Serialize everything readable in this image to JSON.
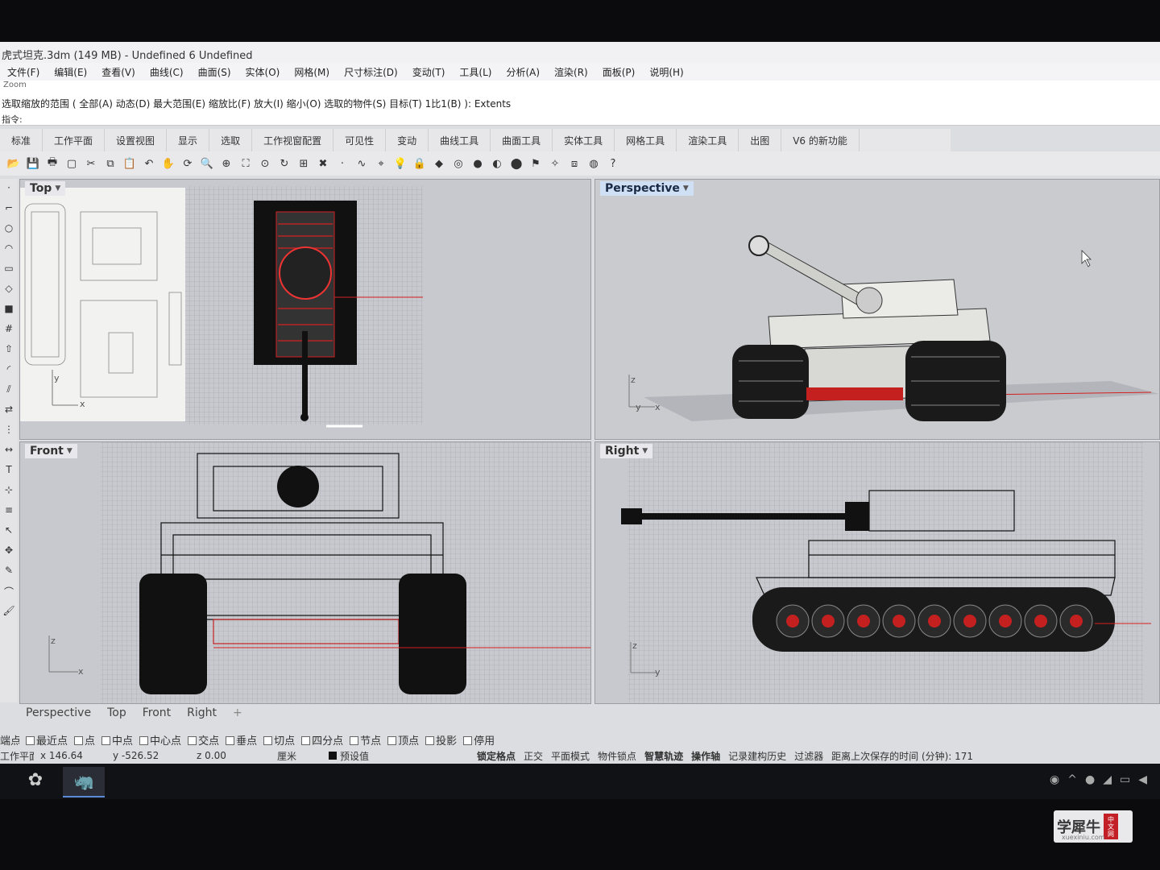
{
  "window": {
    "title": "虎式坦克.3dm (149 MB) - Undefined 6 Undefined"
  },
  "menu": [
    "文件(F)",
    "编辑(E)",
    "查看(V)",
    "曲线(C)",
    "曲面(S)",
    "实体(O)",
    "网格(M)",
    "尺寸标注(D)",
    "变动(T)",
    "工具(L)",
    "分析(A)",
    "渲染(R)",
    "面板(P)",
    "说明(H)"
  ],
  "command": {
    "history": "Zoom",
    "prompt": "选取缩放的范围 ( 全部(A)  动态(D)  最大范围(E)  缩放比(F)  放大(I)  缩小(O)  选取的物件(S)  目标(T)  1比1(B) ):  Extents",
    "input_label": "指令:",
    "input_value": ""
  },
  "tabs": [
    "标准",
    "工作平面",
    "设置视图",
    "显示",
    "选取",
    "工作视窗配置",
    "可见性",
    "变动",
    "曲线工具",
    "曲面工具",
    "实体工具",
    "网格工具",
    "渲染工具",
    "出图",
    "V6 的新功能"
  ],
  "toolbar_icons": [
    "open-icon",
    "save-icon",
    "print-icon",
    "new-icon",
    "cut-icon",
    "copy-icon",
    "paste-icon",
    "undo-icon",
    "pan-icon",
    "rotate-icon",
    "zoom-icon",
    "zoom-window-icon",
    "zoom-extents-icon",
    "zoom-selected-icon",
    "rotate-view-icon",
    "layout-icon",
    "delete-icon",
    "point-icon",
    "curve-icon",
    "osnap-icon",
    "light-icon",
    "lock-icon",
    "material-icon",
    "color-wheel-icon",
    "shade-icon",
    "render-icon",
    "ball-icon",
    "tag-icon",
    "magic-icon",
    "group-icon",
    "globe-icon",
    "help-icon"
  ],
  "left_tool_icons": [
    "point-icon",
    "polyline-icon",
    "circle-icon",
    "arc-icon",
    "rectangle-icon",
    "surface-icon",
    "solid-icon",
    "mesh-icon",
    "extrude-icon",
    "fillet-icon",
    "split-icon",
    "transform-icon",
    "array-icon",
    "dim-icon",
    "text-icon",
    "snap-icon",
    "layer-icon",
    "select-icon",
    "move-icon",
    "edit-icon",
    "curve-tool-icon",
    "paint-icon"
  ],
  "viewports": {
    "top": {
      "label": "Top",
      "axis_x": "x",
      "axis_y": "y"
    },
    "perspective": {
      "label": "Perspective",
      "axis_x": "x",
      "axis_y": "y",
      "axis_z": "z"
    },
    "front": {
      "label": "Front",
      "axis_x": "x",
      "axis_z": "z"
    },
    "right": {
      "label": "Right",
      "axis_y": "y",
      "axis_z": "z"
    }
  },
  "viewport_tabs": [
    "Perspective",
    "Top",
    "Front",
    "Right"
  ],
  "osnap": {
    "label": "端点",
    "items": [
      "最近点",
      "点",
      "中点",
      "中心点",
      "交点",
      "垂点",
      "切点",
      "四分点",
      "节点",
      "顶点",
      "投影",
      "停用"
    ]
  },
  "status": {
    "cplane": "工作平面",
    "x": "x 146.64",
    "y": "y -526.52",
    "z": "z 0.00",
    "unit": "厘米",
    "layer": "预设值",
    "modes": [
      "锁定格点",
      "正交",
      "平面模式",
      "物件锁点",
      "智慧轨迹",
      "操作轴",
      "记录建构历史",
      "过滤器"
    ],
    "save_info": "距离上次保存的时间 (分钟): 171"
  },
  "watermark": {
    "text": "学犀牛",
    "badge": [
      "中",
      "文",
      "网"
    ],
    "url": "xuexiniu.com"
  },
  "colors": {
    "accent": "#cfe0f5",
    "axis_red": "#d42020",
    "model_dark": "#111111"
  }
}
